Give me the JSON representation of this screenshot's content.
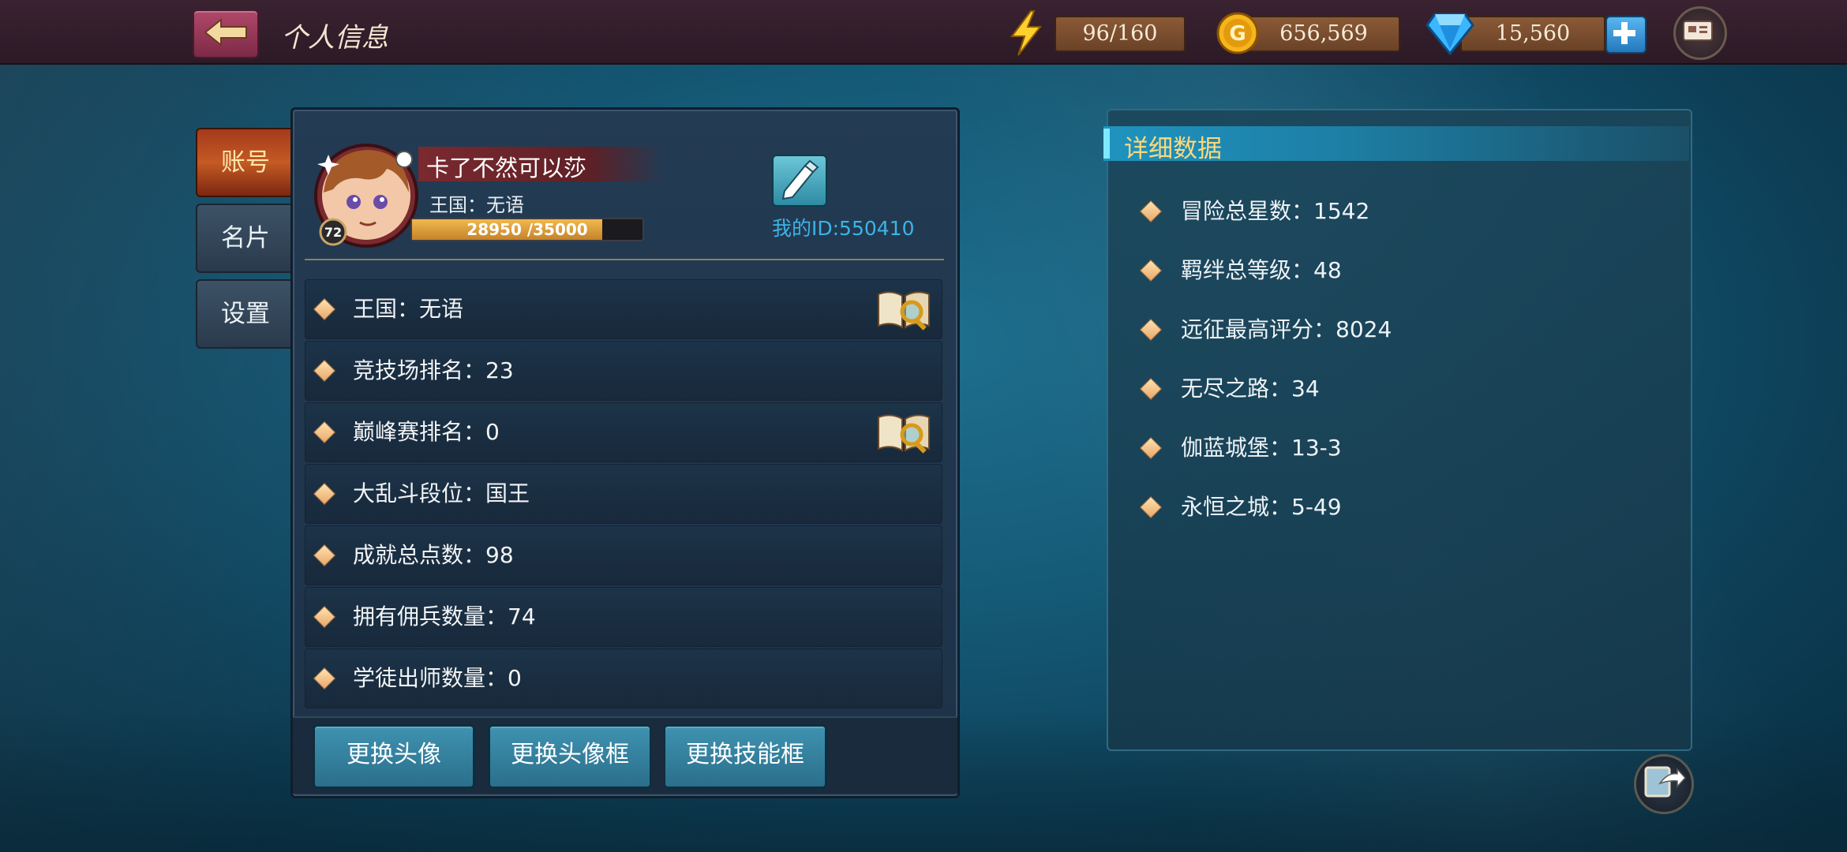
{
  "header": {
    "title": "个人信息",
    "energy": "96/160",
    "gold": "656,569",
    "diamonds": "15,560"
  },
  "tabs": [
    {
      "label": "账号",
      "active": true
    },
    {
      "label": "名片",
      "active": false
    },
    {
      "label": "设置",
      "active": false
    }
  ],
  "profile": {
    "name": "卡了不然可以莎",
    "kingdom": "王国：无语",
    "level": "72",
    "xp_text": "28950 /35000",
    "xp_fraction": 0.827,
    "my_id": "我的ID:550410"
  },
  "rows": [
    {
      "text": "王国：无语",
      "lookup": true
    },
    {
      "text": "竞技场排名：23",
      "lookup": false
    },
    {
      "text": "巅峰赛排名：0",
      "lookup": true
    },
    {
      "text": "大乱斗段位：国王",
      "lookup": false
    },
    {
      "text": "成就总点数：98",
      "lookup": false
    },
    {
      "text": "拥有佣兵数量：74",
      "lookup": false
    },
    {
      "text": "学徒出师数量：0",
      "lookup": false
    }
  ],
  "actions": {
    "change_avatar": "更换头像",
    "change_frame": "更换头像框",
    "change_skill_frame": "更换技能框"
  },
  "details": {
    "title": "详细数据",
    "stats": [
      "冒险总星数：1542",
      "羁绊总等级：48",
      "远征最高评分：8024",
      "无尽之路：34",
      "伽蓝城堡：13-3",
      "永恒之城：5-49"
    ]
  },
  "colors": {
    "accent_blue": "#3cb4e6",
    "active_tab": "#c45a24",
    "header_title": "#ffd87a"
  }
}
